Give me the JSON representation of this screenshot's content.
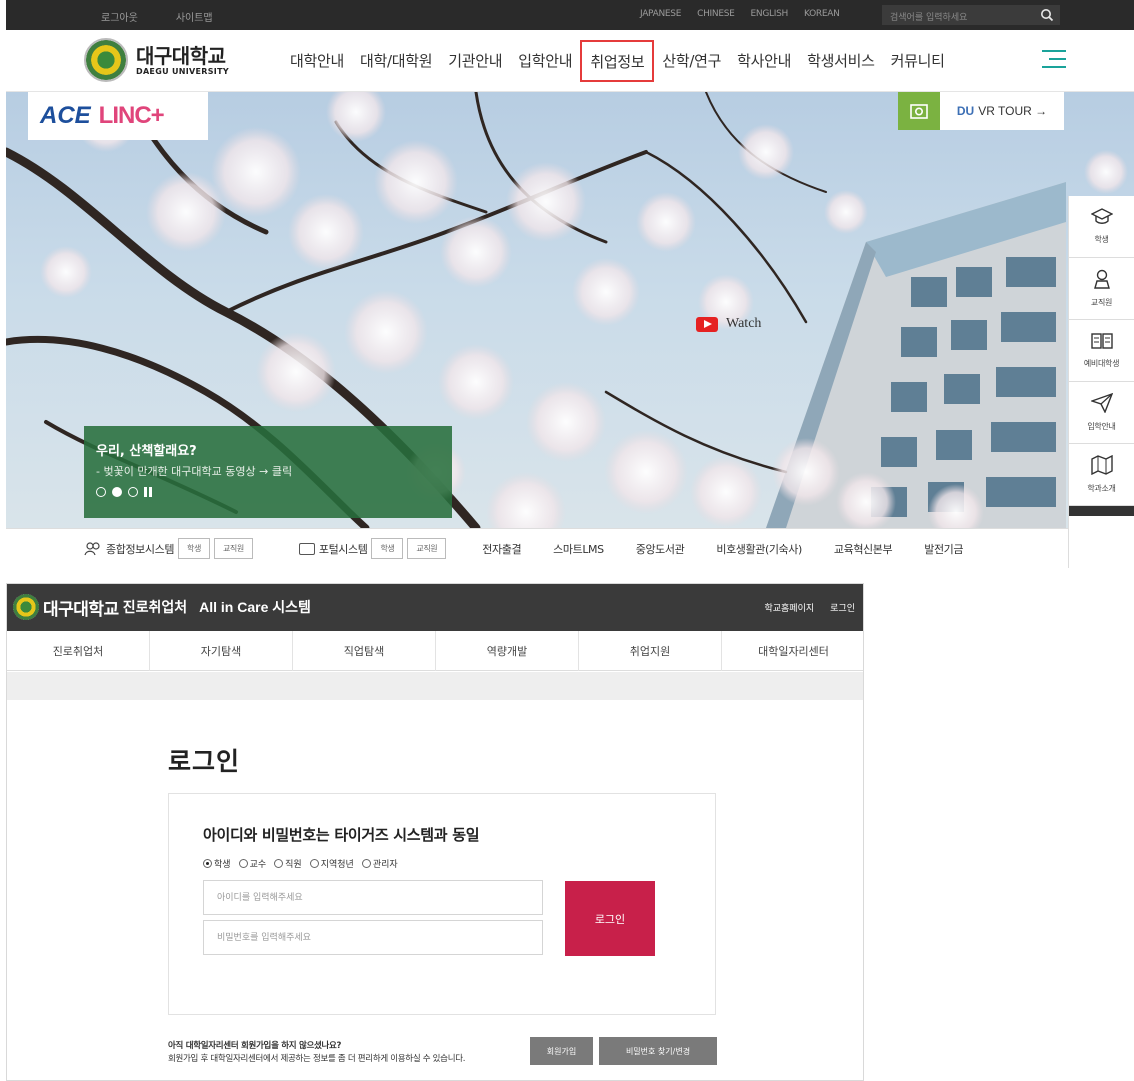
{
  "top": {
    "utility": {
      "links": [
        "로그아웃",
        "사이트맵"
      ],
      "languages": [
        "JAPANESE",
        "CHINESE",
        "ENGLISH",
        "KOREAN"
      ],
      "search_placeholder": "검색어를 입력하세요",
      "search_icon": "search-icon"
    },
    "logo": {
      "korean": "대구대학교",
      "english": "DAEGU UNIVERSITY"
    },
    "nav": [
      "대학안내",
      "대학/대학원",
      "기관안내",
      "입학안내",
      "취업정보",
      "산학/연구",
      "학사안내",
      "학생서비스",
      "커뮤니티"
    ],
    "nav_highlight_index": 4,
    "hero": {
      "ace": "ACE",
      "linc": "LINC+",
      "vr_brand": "DU",
      "vr_label": "VR TOUR →",
      "watch": "Watch",
      "caption_title": "우리, 산책할래요?",
      "caption_sub": "- 벚꽃이 만개한 대구대학교 동영상 → 클릭",
      "slide_active": 2,
      "slide_count": 3
    },
    "quick_menu": [
      {
        "label": "학생",
        "icon": "graduation-cap-icon"
      },
      {
        "label": "교직원",
        "icon": "person-icon"
      },
      {
        "label": "예비대학생",
        "icon": "book-icon"
      },
      {
        "label": "입학안내",
        "icon": "paper-plane-icon"
      },
      {
        "label": "학과소개",
        "icon": "map-icon"
      }
    ],
    "link_bar": {
      "info_system": "종합정보시스템",
      "portal": "포털시스템",
      "chip_student": "학생",
      "chip_staff": "교직원",
      "links": [
        "전자출결",
        "스마트LMS",
        "중앙도서관",
        "비호생활관(기숙사)",
        "교육혁신본부",
        "발전기금"
      ]
    }
  },
  "bottom": {
    "header": {
      "brand": "대구대학교",
      "sub": "진로취업처",
      "system": "All in Care 시스템",
      "links": [
        "학교홈페이지",
        "로그인"
      ]
    },
    "menu": [
      "진로취업처",
      "자기탐색",
      "직업탐색",
      "역량개발",
      "취업지원",
      "대학일자리센터"
    ],
    "login": {
      "title": "로그인",
      "heading": "아이디와 비밀번호는 타이거즈 시스템과 동일",
      "roles": [
        "학생",
        "교수",
        "직원",
        "지역청년",
        "관리자"
      ],
      "selected_role": "학생",
      "id_placeholder": "아이디를 입력해주세요",
      "pw_placeholder": "비밀번호를 입력해주세요",
      "button": "로그인"
    },
    "signup": {
      "line1": "아직 대학일자리센터 회원가입을 하지 않으셨나요?",
      "line2": "회원가입 후 대학일자리센터에서 제공하는 정보를 좀 더 편리하게 이용하실 수 있습니다.",
      "join_button": "회원가입",
      "find_button": "비밀번호 찾기/변경"
    }
  }
}
